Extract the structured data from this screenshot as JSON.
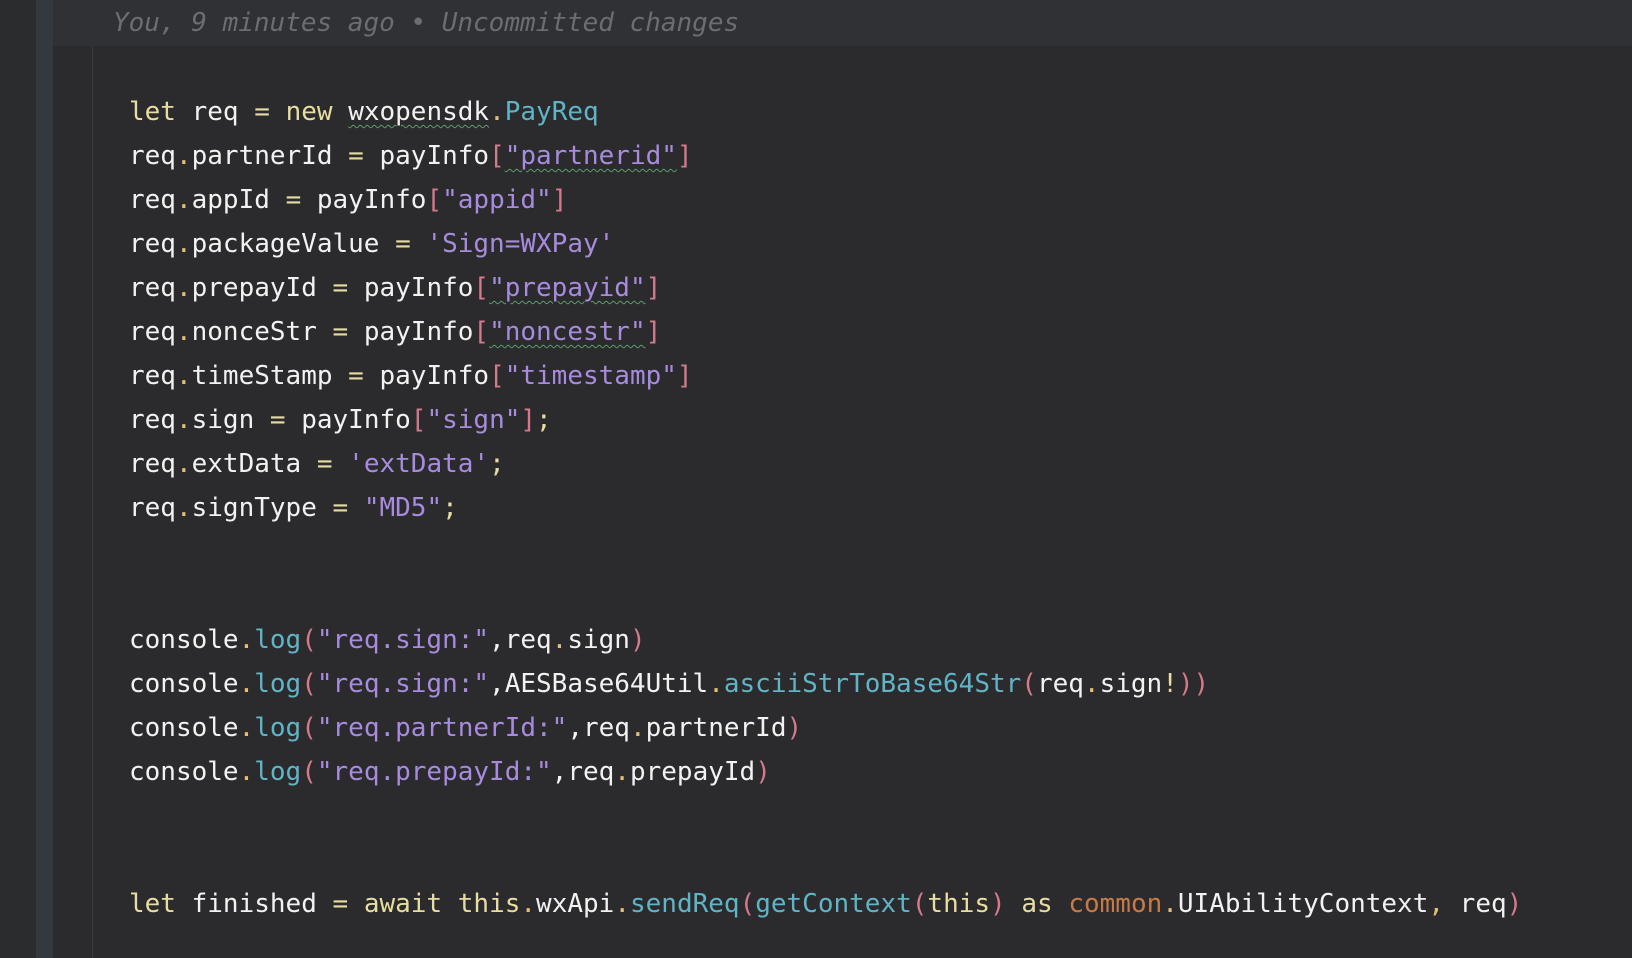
{
  "blame_annotation": "You, 9 minutes ago • Uncommitted changes",
  "code": {
    "l1": {
      "kw_let": "let",
      "var": "req",
      "eq": "=",
      "kw_new": "new",
      "ns": "wxopensdk",
      "dot": ".",
      "cls": "PayReq"
    },
    "l2": {
      "obj": "req",
      "dot": ".",
      "prop": "partnerId",
      "eq": "=",
      "src": "payInfo",
      "lb": "[",
      "key": "\"partnerid\"",
      "rb": "]"
    },
    "l3": {
      "obj": "req",
      "dot": ".",
      "prop": "appId",
      "eq": "=",
      "src": "payInfo",
      "lb": "[",
      "key": "\"appid\"",
      "rb": "]"
    },
    "l4": {
      "obj": "req",
      "dot": ".",
      "prop": "packageValue",
      "eq": "=",
      "val": "'Sign=WXPay'"
    },
    "l5": {
      "obj": "req",
      "dot": ".",
      "prop": "prepayId",
      "eq": "=",
      "src": "payInfo",
      "lb": "[",
      "key": "\"prepayid\"",
      "rb": "]"
    },
    "l6": {
      "obj": "req",
      "dot": ".",
      "prop": "nonceStr",
      "eq": "=",
      "src": "payInfo",
      "lb": "[",
      "key": "\"noncestr\"",
      "rb": "]"
    },
    "l7": {
      "obj": "req",
      "dot": ".",
      "prop": "timeStamp",
      "eq": "=",
      "src": "payInfo",
      "lb": "[",
      "key": "\"timestamp\"",
      "rb": "]"
    },
    "l8": {
      "obj": "req",
      "dot": ".",
      "prop": "sign",
      "eq": "=",
      "src": "payInfo",
      "lb": "[",
      "key": "\"sign\"",
      "rb": "]",
      "semi": ";"
    },
    "l9": {
      "obj": "req",
      "dot": ".",
      "prop": "extData",
      "eq": "=",
      "val": "'extData'",
      "semi": ";"
    },
    "l10": {
      "obj": "req",
      "dot": ".",
      "prop": "signType",
      "eq": "=",
      "val": "\"MD5\"",
      "semi": ";"
    },
    "l11": {
      "obj": "console",
      "dot": ".",
      "fn": "log",
      "lp": "(",
      "arg1": "\"req.sign:\"",
      "comma": ",",
      "a2obj": "req",
      "a2dot": ".",
      "a2prop": "sign",
      "rp": ")"
    },
    "l12": {
      "obj": "console",
      "dot": ".",
      "fn": "log",
      "lp": "(",
      "arg1": "\"req.sign:\"",
      "comma": ",",
      "util": "AESBase64Util",
      "udot": ".",
      "ufn": "asciiStrToBase64Str",
      "ulp": "(",
      "a2obj": "req",
      "a2dot": ".",
      "a2prop": "sign",
      "bang": "!",
      "urp": ")",
      "rp": ")"
    },
    "l13": {
      "obj": "console",
      "dot": ".",
      "fn": "log",
      "lp": "(",
      "arg1": "\"req.partnerId:\"",
      "comma": ",",
      "a2obj": "req",
      "a2dot": ".",
      "a2prop": "partnerId",
      "rp": ")"
    },
    "l14": {
      "obj": "console",
      "dot": ".",
      "fn": "log",
      "lp": "(",
      "arg1": "\"req.prepayId:\"",
      "comma": ",",
      "a2obj": "req",
      "a2dot": ".",
      "a2prop": "prepayId",
      "rp": ")"
    },
    "l15": {
      "kw_let": "let",
      "var": "finished",
      "eq": "=",
      "kw_await": "await",
      "kw_this": "this",
      "dot": ".",
      "api": "wxApi",
      "dot2": ".",
      "fn": "sendReq",
      "lp": "(",
      "gc": "getContext",
      "glp": "(",
      "gthis": "this",
      "grp": ")",
      "kw_as": "as",
      "mod": "common",
      "mdot": ".",
      "ctx": "UIAbilityContext",
      "comma": ",",
      "arg2": "req",
      "rp": ")"
    }
  }
}
